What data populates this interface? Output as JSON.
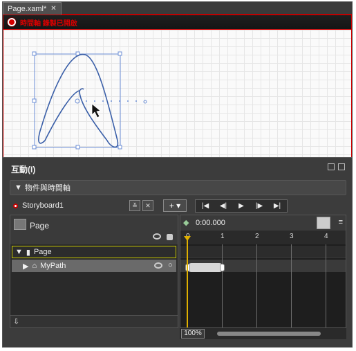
{
  "document_tab": {
    "label": "Page.xaml*",
    "close": "✕"
  },
  "recording_banner": {
    "text": "時間軸 錄製已開啟",
    "color": "#d80000"
  },
  "panel": {
    "title": "互動(I)",
    "section_title": "物件與時間軸",
    "storyboard": "Storyboard1",
    "add_label": "+ ▾",
    "transport": [
      "|◀",
      "◀|",
      "▶",
      "|▶",
      "▶|"
    ]
  },
  "tree": {
    "scope_label": "Page",
    "items": [
      {
        "label": "Page",
        "expander": "▼"
      },
      {
        "label": "MyPath",
        "expander": "▶"
      }
    ]
  },
  "timeline": {
    "current_time": "0:00.000",
    "ticks": [
      "0",
      "1",
      "2",
      "3",
      "4"
    ],
    "zoom": "100%",
    "playhead_color": "#e0b000"
  },
  "colors": {
    "accent_red": "#cc0000",
    "path_stroke": "#3a5fa8",
    "selection": "#6c8fd6"
  }
}
